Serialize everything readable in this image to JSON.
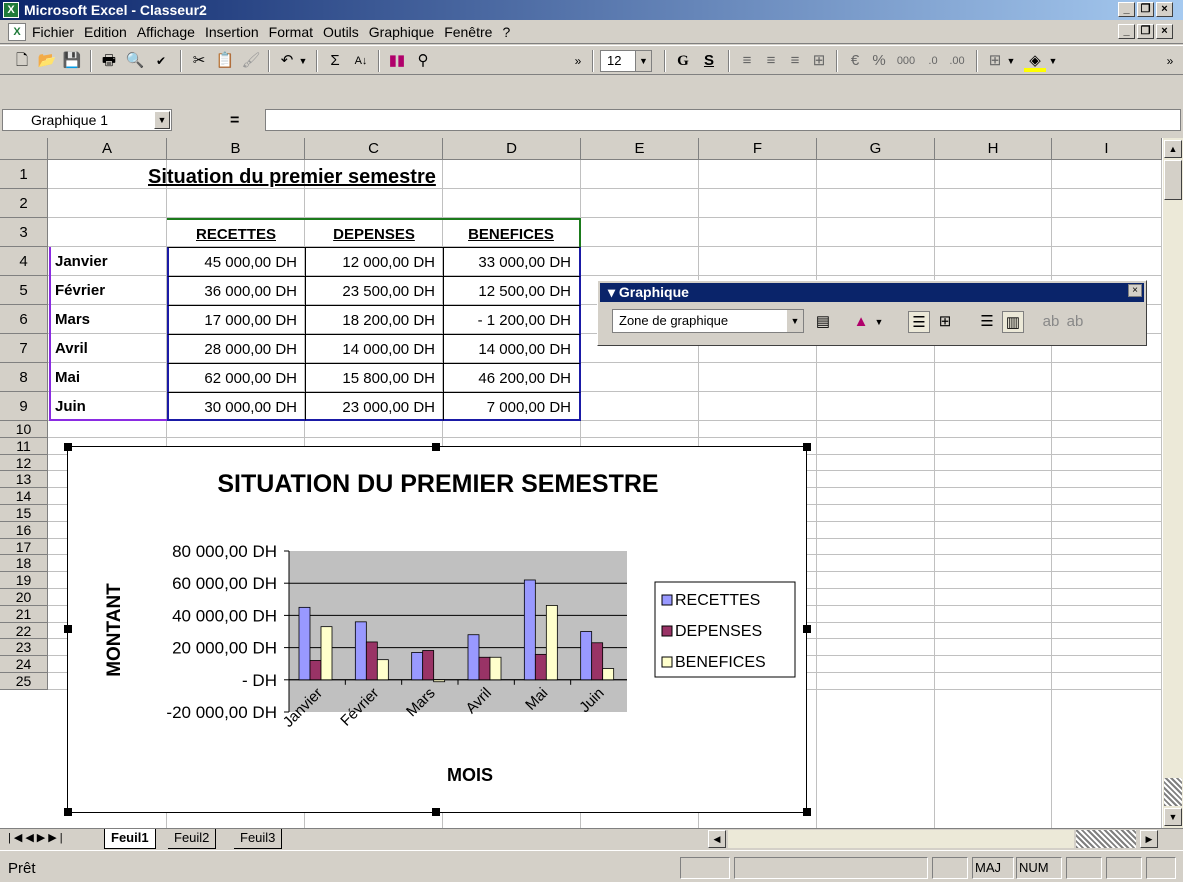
{
  "window": {
    "title": "Microsoft Excel - Classeur2"
  },
  "menu": [
    "Fichier",
    "Edition",
    "Affichage",
    "Insertion",
    "Format",
    "Outils",
    "Graphique",
    "Fenêtre",
    "?"
  ],
  "toolbar": {
    "font_size": "12",
    "bold": "G",
    "underline": "S"
  },
  "formula_bar": {
    "name_box": "Graphique 1",
    "eq": "="
  },
  "columns": [
    "A",
    "B",
    "C",
    "D",
    "E",
    "F",
    "G",
    "H",
    "I"
  ],
  "rows": [
    "1",
    "2",
    "3",
    "4",
    "5",
    "6",
    "7",
    "8",
    "9",
    "10",
    "11",
    "12",
    "13",
    "14",
    "15",
    "16",
    "17",
    "18",
    "19",
    "20",
    "21",
    "22",
    "23",
    "24",
    "25"
  ],
  "sheet": {
    "title": "Situation du premier semestre",
    "headers": [
      "RECETTES",
      "DEPENSES",
      "BENEFICES"
    ],
    "data": [
      {
        "month": "Janvier",
        "recettes": "45 000,00 DH",
        "depenses": "12 000,00 DH",
        "benefices": "33 000,00 DH"
      },
      {
        "month": "Février",
        "recettes": "36 000,00 DH",
        "depenses": "23 500,00 DH",
        "benefices": "12 500,00 DH"
      },
      {
        "month": "Mars",
        "recettes": "17 000,00 DH",
        "depenses": "18 200,00 DH",
        "benefices": "-   1 200,00 DH"
      },
      {
        "month": "Avril",
        "recettes": "28 000,00 DH",
        "depenses": "14 000,00 DH",
        "benefices": "14 000,00 DH"
      },
      {
        "month": "Mai",
        "recettes": "62 000,00 DH",
        "depenses": "15 800,00 DH",
        "benefices": "46 200,00 DH"
      },
      {
        "month": "Juin",
        "recettes": "30 000,00 DH",
        "depenses": "23 000,00 DH",
        "benefices": "7 000,00 DH"
      }
    ]
  },
  "chart_toolbar": {
    "title": "Graphique",
    "selection": "Zone de graphique"
  },
  "chart_data": {
    "type": "bar",
    "title": "SITUATION DU PREMIER SEMESTRE",
    "xlabel": "MOIS",
    "ylabel": "MONTANT",
    "categories": [
      "Janvier",
      "Février",
      "Mars",
      "Avril",
      "Mai",
      "Juin"
    ],
    "series": [
      {
        "name": "RECETTES",
        "values": [
          45000,
          36000,
          17000,
          28000,
          62000,
          30000
        ],
        "color": "#9999ff"
      },
      {
        "name": "DEPENSES",
        "values": [
          12000,
          23500,
          18200,
          14000,
          15800,
          23000
        ],
        "color": "#993366"
      },
      {
        "name": "BENEFICES",
        "values": [
          33000,
          12500,
          -1200,
          14000,
          46200,
          7000
        ],
        "color": "#ffffcc"
      }
    ],
    "ylim": [
      -20000,
      80000
    ],
    "yticks": [
      "80 000,00 DH",
      "60 000,00 DH",
      "40 000,00 DH",
      "20 000,00 DH",
      "-      DH",
      "-20 000,00 DH"
    ],
    "plot_bg": "#c0c0c0",
    "grid": true,
    "legend": "right"
  },
  "sheet_tabs": [
    "Feuil1",
    "Feuil2",
    "Feuil3"
  ],
  "status": {
    "ready": "Prêt",
    "caps": "MAJ",
    "num": "NUM"
  }
}
